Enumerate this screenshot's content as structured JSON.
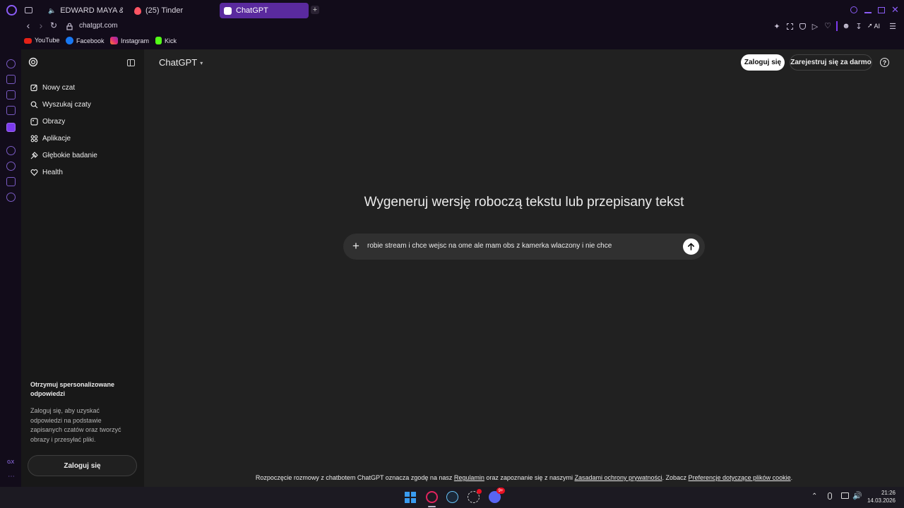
{
  "browser": {
    "tabs": [
      {
        "label": "EDWARD MAYA & VIKA",
        "icon": "youtube-icon"
      },
      {
        "label": "(25) Tinder",
        "icon": "tinder-icon"
      },
      {
        "label": "ChatGPT",
        "icon": "chatgpt-icon",
        "active": true
      }
    ],
    "url": "chatgpt.com",
    "bookmarks": [
      {
        "label": "YouTube",
        "color": "#e62117"
      },
      {
        "label": "Facebook",
        "color": "#1877f2"
      },
      {
        "label": "Instagram",
        "color": "#d6249f"
      },
      {
        "label": "Kick",
        "color": "#53fc18"
      }
    ],
    "ai_label": "AI",
    "side_label": "GX"
  },
  "sidebar": {
    "items": [
      {
        "label": "Nowy czat",
        "icon": "new-chat-icon"
      },
      {
        "label": "Wyszukaj czaty",
        "icon": "search-icon"
      },
      {
        "label": "Obrazy",
        "icon": "images-icon"
      },
      {
        "label": "Aplikacje",
        "icon": "apps-icon"
      },
      {
        "label": "Głębokie badanie",
        "icon": "deep-research-icon"
      },
      {
        "label": "Health",
        "icon": "heart-icon"
      }
    ],
    "promo_title": "Otrzymuj spersonalizowane odpowiedzi",
    "promo_text": "Zaloguj się, aby uzyskać odpowiedzi na podstawie zapisanych czatów oraz tworzyć obrazy i przesyłać pliki.",
    "login_button": "Zaloguj się"
  },
  "header": {
    "model": "ChatGPT",
    "login": "Zaloguj się",
    "signup": "Zarejestruj się za darmo",
    "help": "?"
  },
  "main": {
    "heading": "Wygeneruj wersję roboczą tekstu lub przepisany tekst",
    "input_value": "robie stream i chce wejsc na ome ale mam obs z kamerka wlaczony i nie chce"
  },
  "footer": {
    "t1": "Rozpoczęcie rozmowy z chatbotem ChatGPT oznacza zgodę na nasz ",
    "link1": "Regulamin",
    "t2": " oraz zapoznanie się z naszymi ",
    "link2": "Zasadami ochrony prywatności",
    "t3": ". Zobacz ",
    "link3": "Preferencje dotyczące plików cookie",
    "t4": "."
  },
  "taskbar": {
    "time": "21:26",
    "date": "14.03.2026",
    "discord_badge": "9+"
  }
}
